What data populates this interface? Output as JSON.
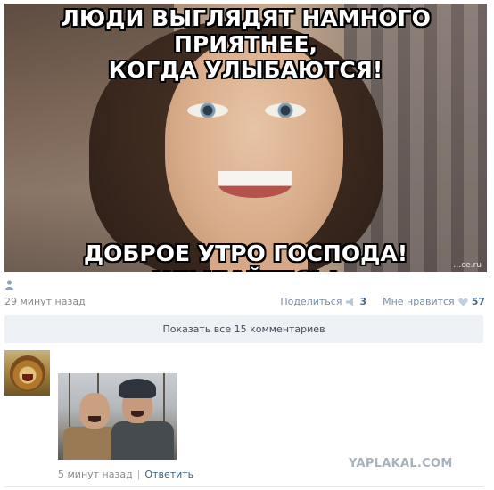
{
  "meme": {
    "top_caption_line1": "ЛЮДИ ВЫГЛЯДЯТ НАМНОГО ПРИЯТНЕЕ,",
    "top_caption_line2": "КОГДА УЛЫБАЮТСЯ!",
    "bottom_caption": "ДОБРОЕ УТРО ГОСПОДА! УЛЫБАЙТЕСЬ!",
    "watermark": "…ce.ru"
  },
  "post": {
    "author_icon": "user-icon",
    "time": "29 минут назад",
    "share_label": "Поделиться",
    "share_count": "3",
    "like_label": "Мне нравится",
    "like_count": "57"
  },
  "comments_bar": {
    "label": "Показать все 15 комментариев"
  },
  "comment": {
    "avatar_icon": "lion-avatar",
    "time": "5 минут назад",
    "separator": "|",
    "reply_label": "Ответить"
  },
  "site_logo": "YAPLAKAL.COM",
  "colors": {
    "bar_bg": "#edf0f5",
    "link": "#3b5f86",
    "count": "#4a6a8e",
    "muted": "#8a8a8a"
  }
}
